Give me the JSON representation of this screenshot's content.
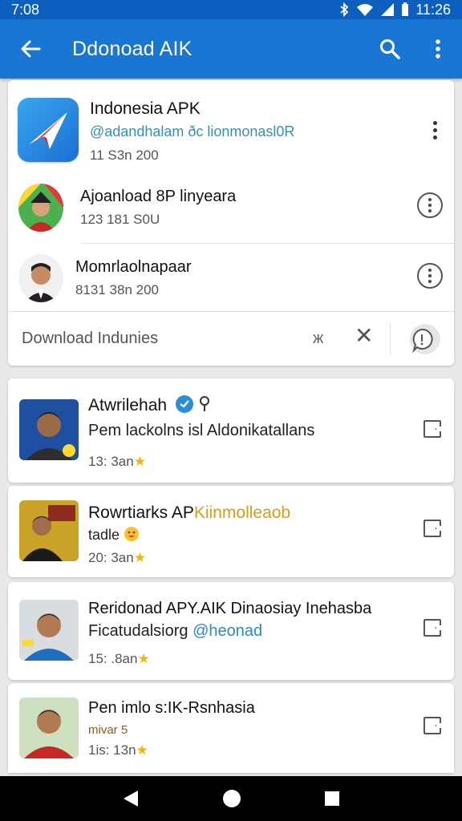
{
  "status_bar": {
    "time": "7:08",
    "clock": "11:26"
  },
  "app_bar": {
    "title": "Ddonoad AIK"
  },
  "featured": {
    "name": "Indonesia APK",
    "handle": "@adandhalam ðc lionmonasl0R",
    "meta": "11 S3n 200"
  },
  "rows": [
    {
      "name": "Ajoanload 8P linyeara",
      "meta": "123 181 S0U"
    },
    {
      "name": "Momrlaolnapaar",
      "meta": "8131 38n 200"
    }
  ],
  "download_bar": {
    "label": "Download Indunies",
    "small_x": "ж"
  },
  "list": [
    {
      "title": "Atwrilehah",
      "sub": "Pem lackolns isl Aldonikatallans",
      "stat": "13: 3an",
      "star": "★"
    },
    {
      "title_a": "Rowrtiarks AP",
      "title_b": "Kiinmolleaob",
      "sub": "tadle",
      "stat": "20: 3an",
      "star": "★"
    },
    {
      "title": "Reridonad APY.AIK Dinaosiay Inehasba",
      "sub_a": "Ficatudalsiorg",
      "sub_b": "@heonad",
      "stat": "15: .8an",
      "star": "★"
    },
    {
      "title": "Pen imlo s:IK-Rsnhasia",
      "sub": "mivar 5",
      "stat": "1is: 13n",
      "star": "★"
    }
  ],
  "colors": {
    "app_bar": "#1976d2",
    "status_bar": "#0d5fbf",
    "star": "#f2b705"
  }
}
